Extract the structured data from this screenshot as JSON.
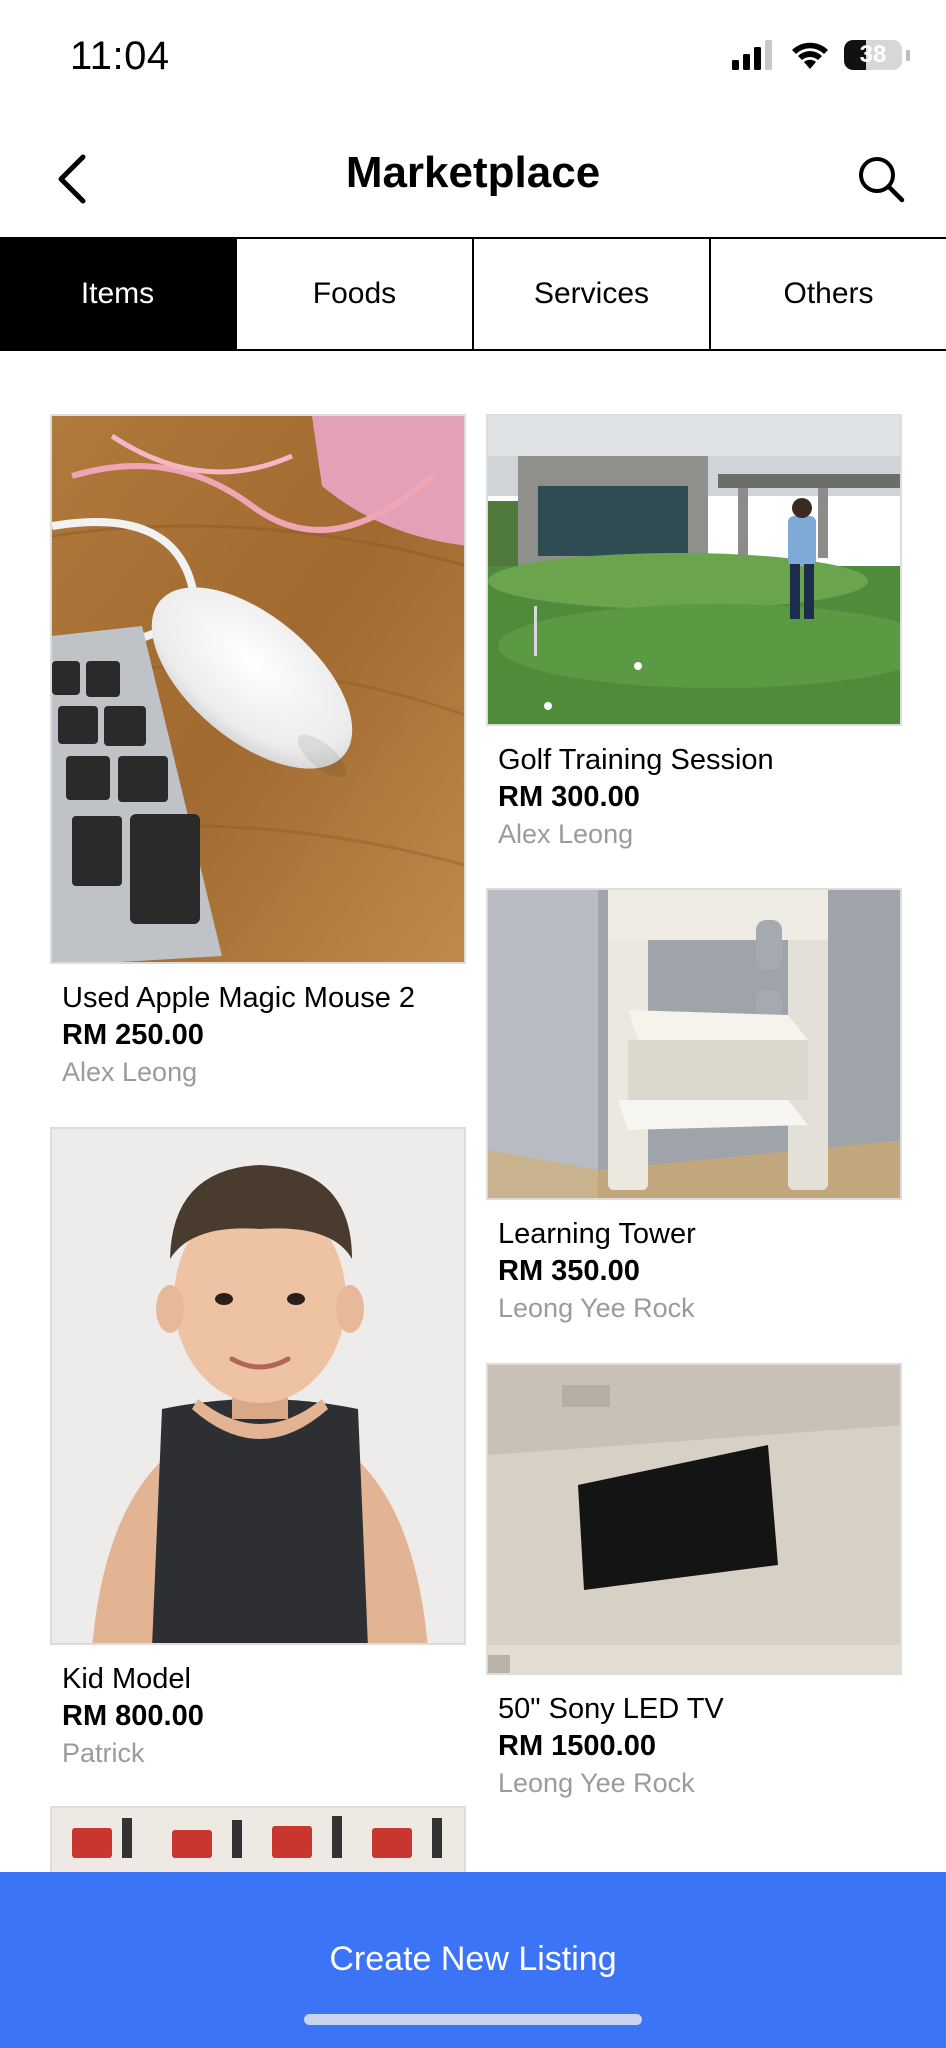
{
  "status_bar": {
    "time": "11:04",
    "battery_percent": "38",
    "battery_level": 0.38,
    "icons": [
      "cellular-signal-icon",
      "wifi-icon",
      "battery-icon"
    ]
  },
  "nav": {
    "title": "Marketplace",
    "back_icon": "chevron-left-icon",
    "search_icon": "search-icon"
  },
  "tabs": [
    {
      "label": "Items",
      "active": true
    },
    {
      "label": "Foods",
      "active": false
    },
    {
      "label": "Services",
      "active": false
    },
    {
      "label": "Others",
      "active": false
    }
  ],
  "listings": [
    {
      "title": "Used Apple Magic Mouse 2",
      "price": "RM 250.00",
      "seller": "Alex Leong",
      "photo": "magic-mouse-photo"
    },
    {
      "title": "Golf Training Session",
      "price": "RM 300.00",
      "seller": "Alex Leong",
      "photo": "golf-green-photo"
    },
    {
      "title": "Learning Tower",
      "price": "RM 350.00",
      "seller": "Leong Yee Rock",
      "photo": "learning-tower-photo"
    },
    {
      "title": "Kid Model",
      "price": "RM 800.00",
      "seller": "Patrick",
      "photo": "kid-portrait-photo"
    },
    {
      "title": "50\" Sony LED TV",
      "price": "RM 1500.00",
      "seller": "Leong Yee Rock",
      "photo": "wall-tv-photo"
    },
    {
      "title": "",
      "price": "",
      "seller": "",
      "photo": "london-pattern-photo"
    }
  ],
  "create_button": {
    "label": "Create New Listing"
  },
  "colors": {
    "accent": "#3b74f6",
    "tab_active_bg": "#000000",
    "tab_active_text": "#ffffff",
    "seller_text": "#9b9b9b"
  }
}
